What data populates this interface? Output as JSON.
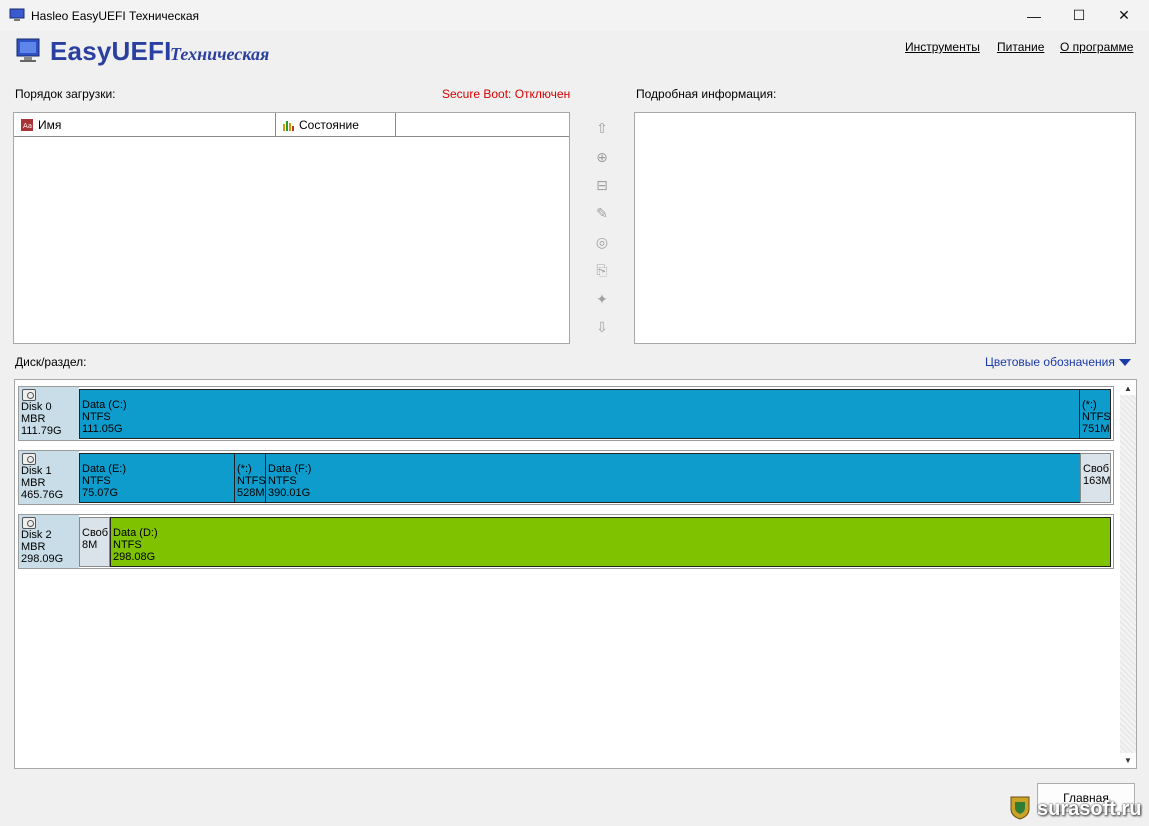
{
  "window": {
    "title": "Hasleo EasyUEFI Техническая",
    "min_glyph": "—",
    "max_glyph": "☐",
    "close_glyph": "✕"
  },
  "header": {
    "logo_text": "EasyUEFI",
    "logo_edition": "Техническая",
    "menu": [
      {
        "label": "Инструменты"
      },
      {
        "label": "Питание"
      },
      {
        "label": "О программе"
      }
    ]
  },
  "boot": {
    "label": "Порядок загрузки:",
    "secure_boot": "Secure Boot: Отключен",
    "columns": [
      {
        "label": "Имя",
        "icon": "name-column-icon"
      },
      {
        "label": "Состояние",
        "icon": "status-column-icon"
      }
    ]
  },
  "toolbar": {
    "buttons": [
      {
        "name": "move-up-icon",
        "glyph": "⇧"
      },
      {
        "name": "add-entry-icon",
        "glyph": "⊕"
      },
      {
        "name": "delete-entry-icon",
        "glyph": "⊟"
      },
      {
        "name": "edit-entry-icon",
        "glyph": "✎"
      },
      {
        "name": "backup-icon",
        "glyph": "◎"
      },
      {
        "name": "restore-icon",
        "glyph": "⎘"
      },
      {
        "name": "tools-icon",
        "glyph": "✦"
      },
      {
        "name": "move-down-icon",
        "glyph": "⇩"
      }
    ]
  },
  "details": {
    "label": "Подробная информация:"
  },
  "disks": {
    "label": "Диск/раздел:",
    "legend_link": "Цветовые обозначения",
    "colors": {
      "data": "#0e9ccc",
      "active": "#7fc200",
      "free": "#dbe3ea"
    },
    "rows": [
      {
        "name": "Disk 0",
        "type": "MBR",
        "size": "111.79G",
        "partitions": [
          {
            "label": "Data (C:)",
            "fs": "NTFS",
            "size": "111.05G",
            "kind": "blue"
          },
          {
            "label": "(*:)",
            "fs": "NTFS",
            "size": "751M",
            "kind": "blue"
          }
        ]
      },
      {
        "name": "Disk 1",
        "type": "MBR",
        "size": "465.76G",
        "partitions": [
          {
            "label": "Data (E:)",
            "fs": "NTFS",
            "size": "75.07G",
            "kind": "blue"
          },
          {
            "label": "(*:)",
            "fs": "NTFS",
            "size": "528M",
            "kind": "blue"
          },
          {
            "label": "Data (F:)",
            "fs": "NTFS",
            "size": "390.01G",
            "kind": "blue"
          },
          {
            "label": "Своб",
            "fs": "163M",
            "size": "",
            "kind": "free"
          }
        ]
      },
      {
        "name": "Disk 2",
        "type": "MBR",
        "size": "298.09G",
        "partitions": [
          {
            "label": "Своб",
            "fs": "8M",
            "size": "",
            "kind": "free"
          },
          {
            "label": "Data (D:)",
            "fs": "NTFS",
            "size": "298.08G",
            "kind": "green"
          }
        ]
      }
    ]
  },
  "footer": {
    "main_button": "Главная",
    "watermark": "surasoft.ru"
  }
}
